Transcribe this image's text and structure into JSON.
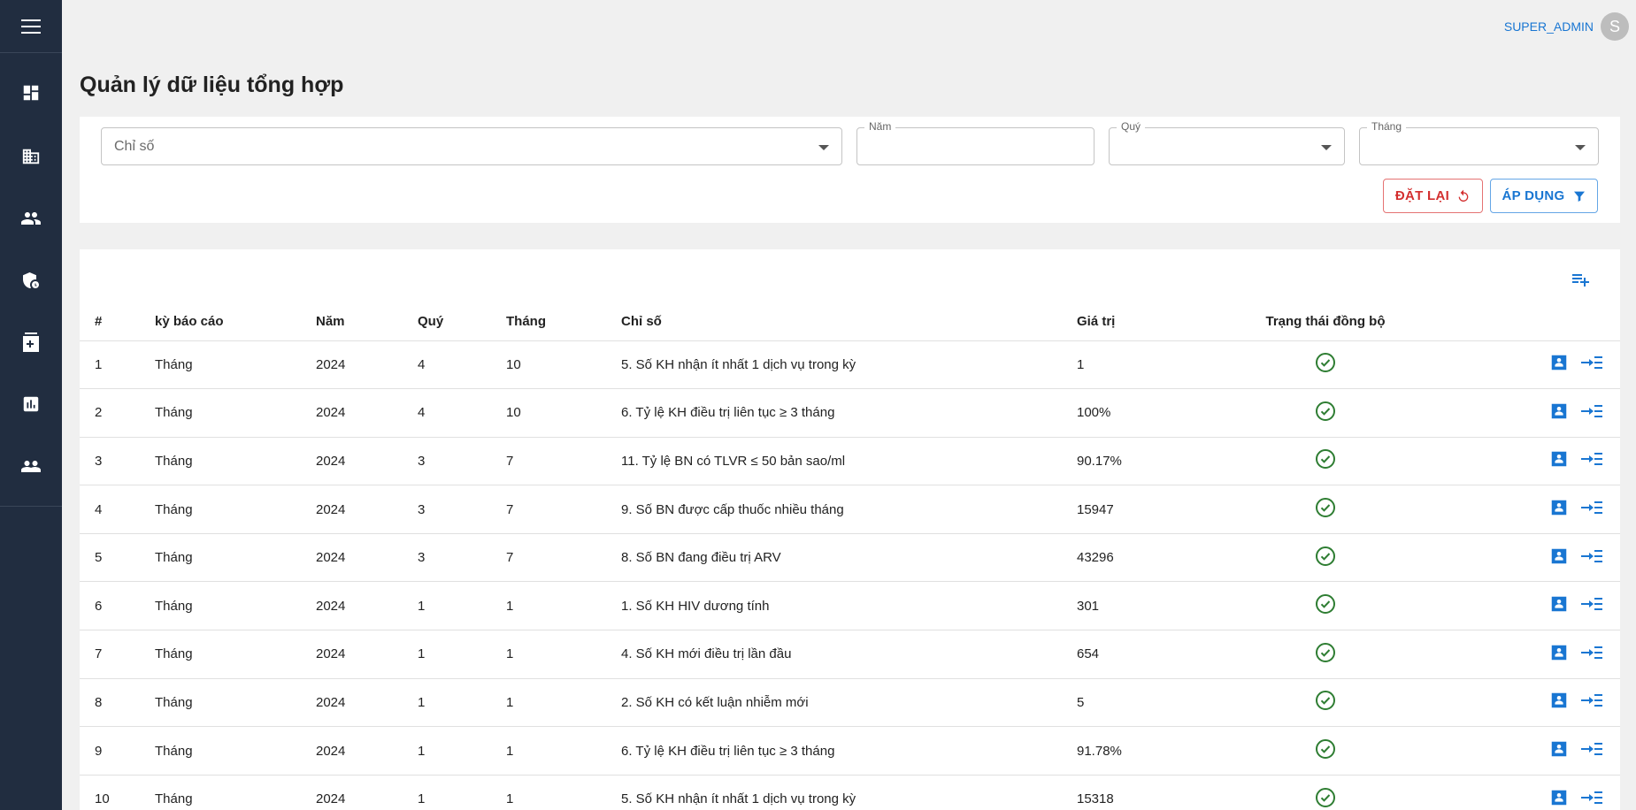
{
  "header": {
    "username": "SUPER_ADMIN",
    "avatar_letter": "S"
  },
  "sidebar": {
    "items": [
      {
        "icon": "dashboard-icon"
      },
      {
        "icon": "building-icon"
      },
      {
        "icon": "users-icon"
      },
      {
        "icon": "briefcase-clock-icon"
      },
      {
        "icon": "medical-box-icon"
      },
      {
        "icon": "bar-chart-icon"
      },
      {
        "icon": "people-icon"
      }
    ]
  },
  "page": {
    "title": "Quản lý dữ liệu tổng hợp"
  },
  "filters": {
    "chiso": {
      "placeholder": "Chỉ số",
      "value": ""
    },
    "nam": {
      "label": "Năm",
      "value": ""
    },
    "quy": {
      "label": "Quý",
      "value": ""
    },
    "thang": {
      "label": "Tháng",
      "value": ""
    },
    "reset_label": "ĐẶT LẠI",
    "apply_label": "ÁP DỤNG"
  },
  "table": {
    "columns": [
      "#",
      "kỳ báo cáo",
      "Năm",
      "Quý",
      "Tháng",
      "Chỉ số",
      "Giá trị",
      "Trạng thái đồng bộ"
    ],
    "rows": [
      {
        "idx": "1",
        "ky": "Tháng",
        "nam": "2024",
        "quy": "4",
        "thang": "10",
        "chiso": "5. Số KH nhận ít nhất 1 dịch vụ trong kỳ",
        "giatri": "1"
      },
      {
        "idx": "2",
        "ky": "Tháng",
        "nam": "2024",
        "quy": "4",
        "thang": "10",
        "chiso": "6. Tỷ lệ KH điều trị liên tục ≥ 3 tháng",
        "giatri": "100%"
      },
      {
        "idx": "3",
        "ky": "Tháng",
        "nam": "2024",
        "quy": "3",
        "thang": "7",
        "chiso": "11. Tỷ lệ BN có TLVR ≤ 50 bản sao/ml",
        "giatri": "90.17%"
      },
      {
        "idx": "4",
        "ky": "Tháng",
        "nam": "2024",
        "quy": "3",
        "thang": "7",
        "chiso": "9. Số BN được cấp thuốc nhiều tháng",
        "giatri": "15947"
      },
      {
        "idx": "5",
        "ky": "Tháng",
        "nam": "2024",
        "quy": "3",
        "thang": "7",
        "chiso": "8. Số BN đang điều trị ARV",
        "giatri": "43296"
      },
      {
        "idx": "6",
        "ky": "Tháng",
        "nam": "2024",
        "quy": "1",
        "thang": "1",
        "chiso": "1. Số KH HIV dương tính",
        "giatri": "301"
      },
      {
        "idx": "7",
        "ky": "Tháng",
        "nam": "2024",
        "quy": "1",
        "thang": "1",
        "chiso": "4. Số KH mới điều trị lần đầu",
        "giatri": "654"
      },
      {
        "idx": "8",
        "ky": "Tháng",
        "nam": "2024",
        "quy": "1",
        "thang": "1",
        "chiso": "2. Số KH có kết luận nhiễm mới",
        "giatri": "5"
      },
      {
        "idx": "9",
        "ky": "Tháng",
        "nam": "2024",
        "quy": "1",
        "thang": "1",
        "chiso": "6. Tỷ lệ KH điều trị liên tục ≥ 3 tháng",
        "giatri": "91.78%"
      },
      {
        "idx": "10",
        "ky": "Tháng",
        "nam": "2024",
        "quy": "1",
        "thang": "1",
        "chiso": "5. Số KH nhận ít nhất 1 dịch vụ trong kỳ",
        "giatri": "15318"
      }
    ]
  },
  "colors": {
    "sidebar_bg": "#212d40",
    "accent": "#1976d2",
    "danger": "#d32f2f",
    "success": "#2e7d32"
  }
}
